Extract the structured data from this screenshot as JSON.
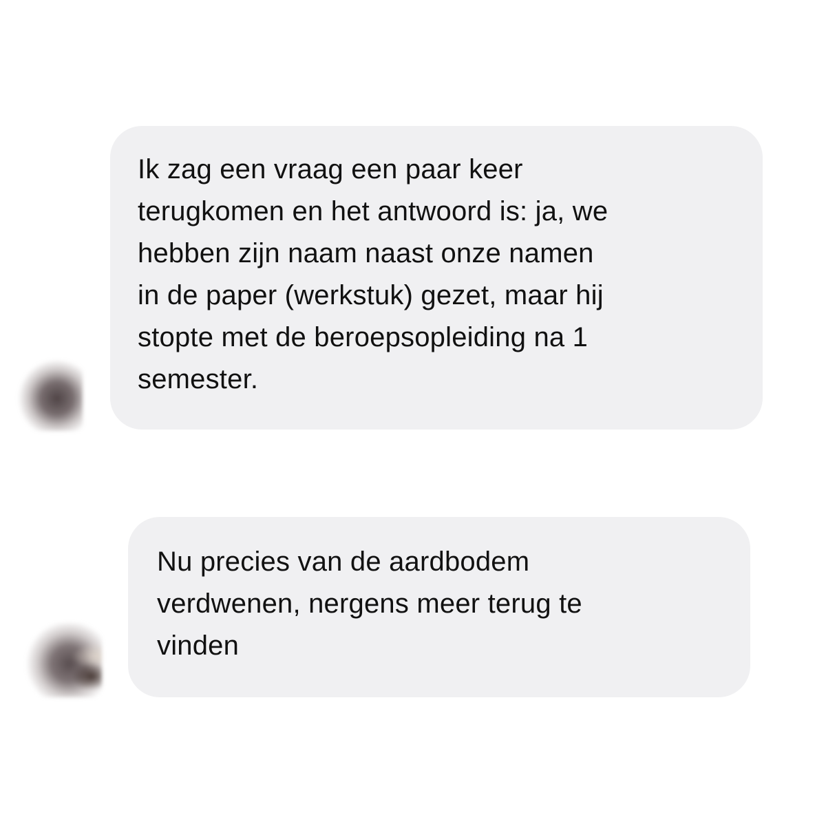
{
  "conversation": {
    "messages": [
      {
        "lines": [
          "Ik zag een vraag een paar keer",
          "terugkomen en het antwoord is: ja, we",
          "hebben zijn naam naast onze namen",
          "in de paper (werkstuk) gezet, maar hij",
          "stopte met de beroepsopleiding na 1",
          "semester."
        ]
      },
      {
        "lines": [
          "Nu precies van de aardbodem",
          "verdwenen, nergens meer terug te",
          "vinden"
        ]
      }
    ]
  },
  "colors": {
    "bubble_background": "#f0f0f2",
    "text": "#111111",
    "page_background": "#ffffff"
  }
}
